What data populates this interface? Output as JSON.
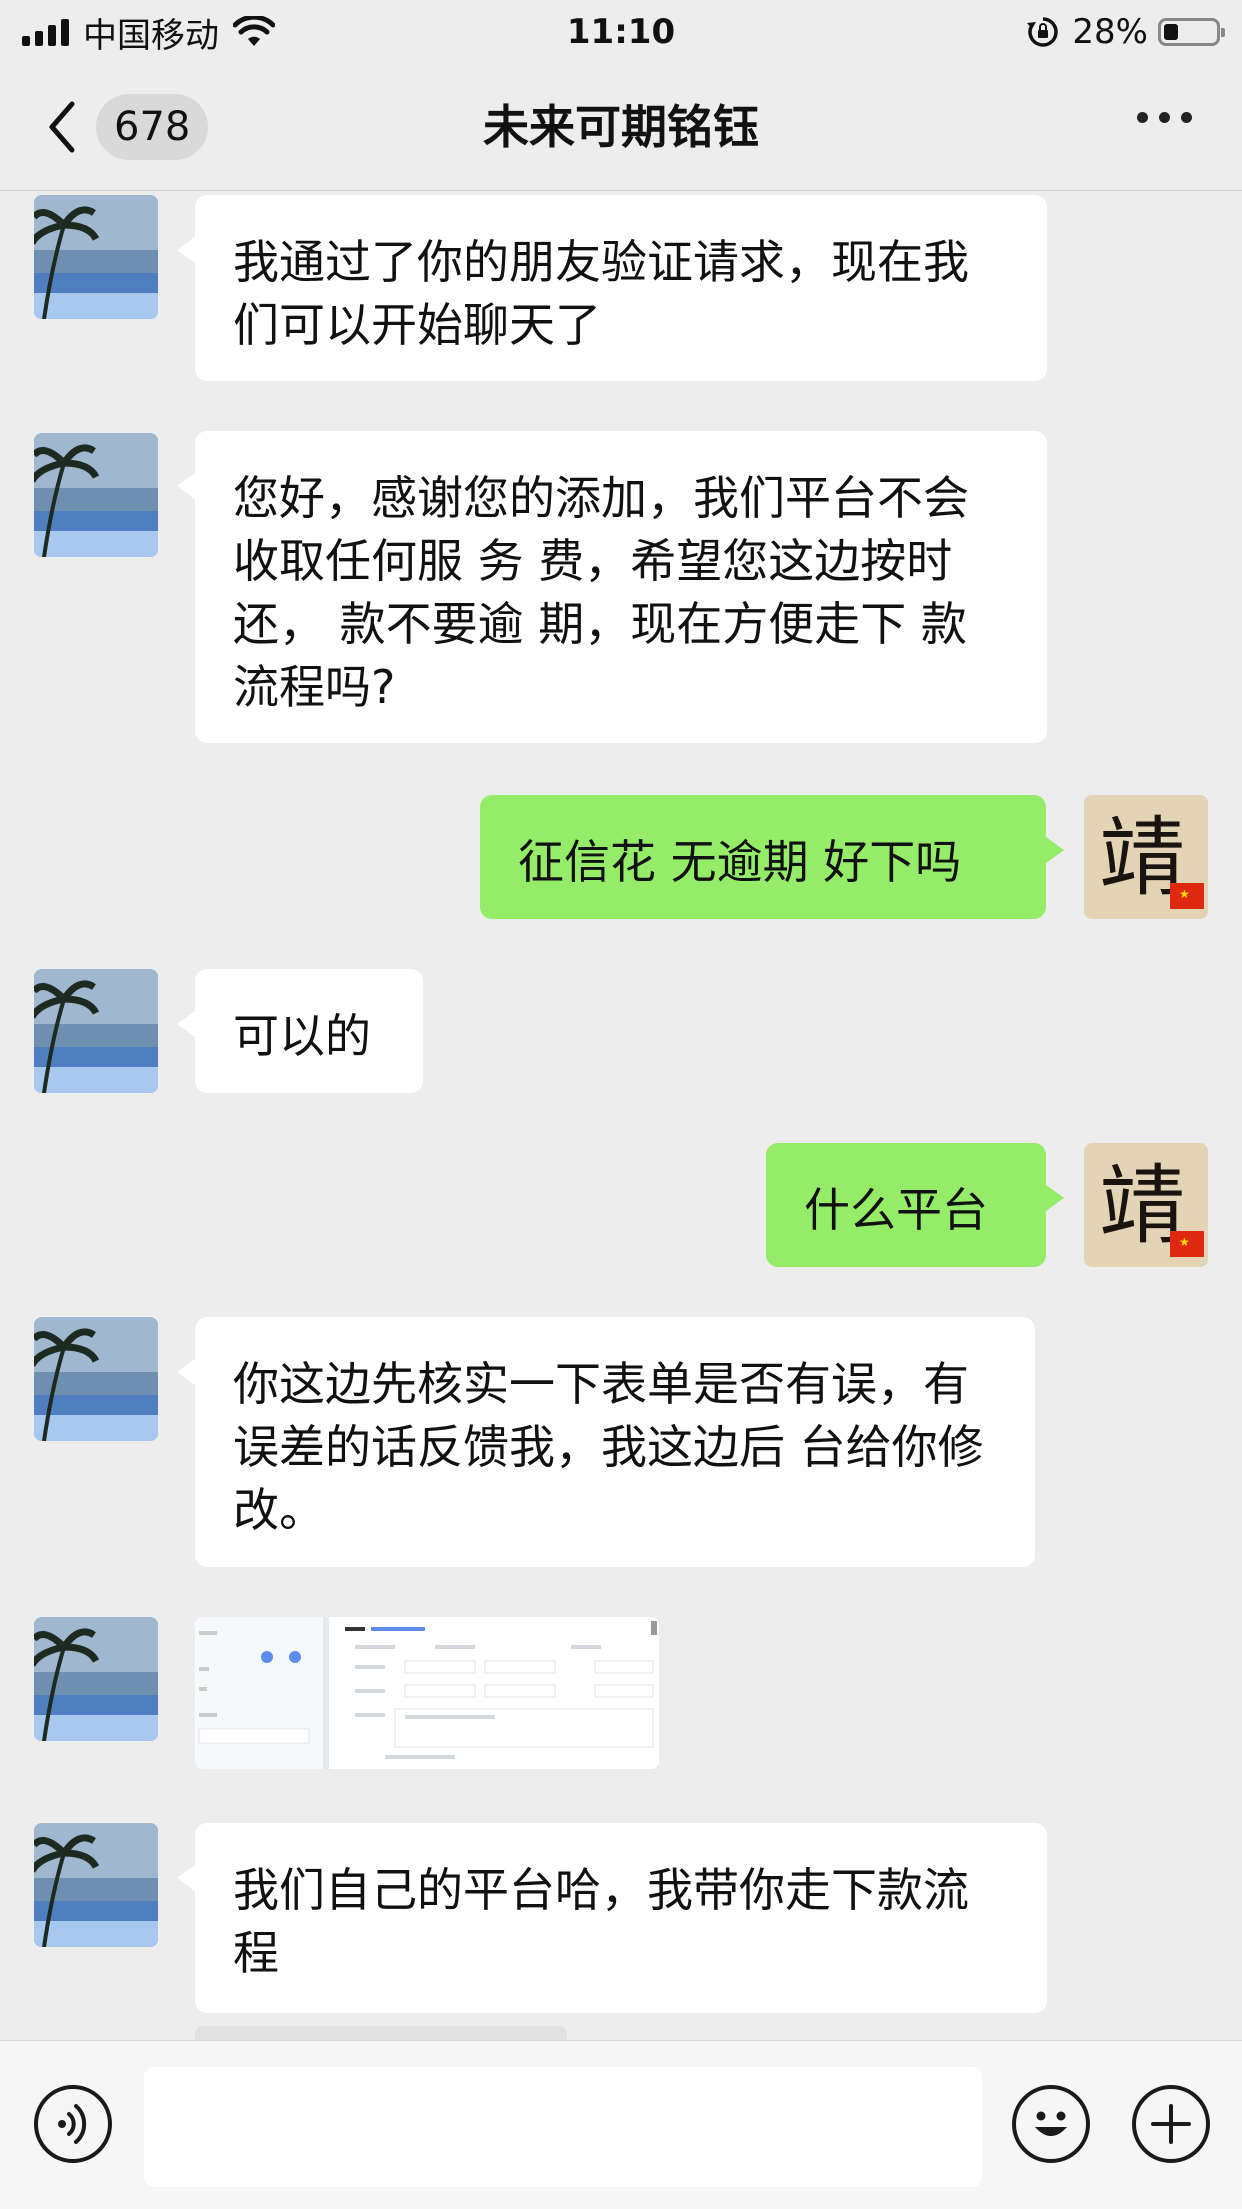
{
  "status_bar": {
    "carrier": "中国移动",
    "time": "11:10",
    "battery": "28%",
    "icons": [
      "signal-icon",
      "wifi-icon",
      "rotation-lock-icon",
      "battery-icon"
    ]
  },
  "nav": {
    "unread_count": "678",
    "title": "未来可期铭钰",
    "icons": [
      "back-chevron-icon",
      "more-icon"
    ]
  },
  "messages": [
    {
      "side": "in",
      "type": "text",
      "text": "我通过了你的朋友验证请求，现在我们可以开始聊天了"
    },
    {
      "side": "in",
      "type": "text",
      "text": "您好，感谢您的添加，我们平台不会收取任何服 务 费，希望您这边按时还， 款不要逾 期，现在方便走下 款流程吗?"
    },
    {
      "side": "out",
      "type": "text",
      "text": "征信花 无逾期 好下吗"
    },
    {
      "side": "in",
      "type": "text",
      "text": "可以的"
    },
    {
      "side": "out",
      "type": "text",
      "text": "什么平台"
    },
    {
      "side": "in",
      "type": "text",
      "text": "你这边先核实一下表单是否有误，有误差的话反馈我，我这边后 台给你修改。"
    },
    {
      "side": "in",
      "type": "image",
      "text": ""
    },
    {
      "side": "in",
      "type": "text",
      "text": "我们自己的平台哈，我带你走下款流程"
    }
  ],
  "sent_avatar_glyph": "靖",
  "input_bar": {
    "icons": [
      "voice-icon",
      "emoji-icon",
      "plus-icon"
    ]
  },
  "colors": {
    "background": "#ededed",
    "incoming_bubble": "#ffffff",
    "outgoing_bubble": "#95ec69"
  }
}
